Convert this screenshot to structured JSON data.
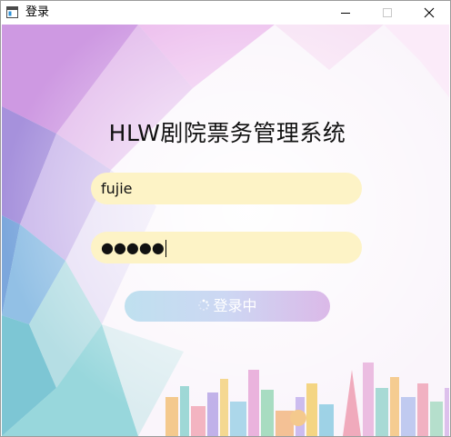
{
  "window": {
    "title": "登录",
    "icon": "app-window-icon",
    "controls": [
      "minimize-icon",
      "maximize-icon",
      "close-icon"
    ]
  },
  "app": {
    "heading": "HLW剧院票务管理系统"
  },
  "form": {
    "username_value": "fujie",
    "password_value": "●●●●●",
    "field_color": "#fdf3c6",
    "login_button_label": "登录中",
    "login_button_icon": "loading-spinner-icon",
    "login_button_state": "loading"
  },
  "colors": {
    "button_gradient_start": "#bfe0ef",
    "button_gradient_end": "#dbb9e8",
    "text": "#111111"
  }
}
